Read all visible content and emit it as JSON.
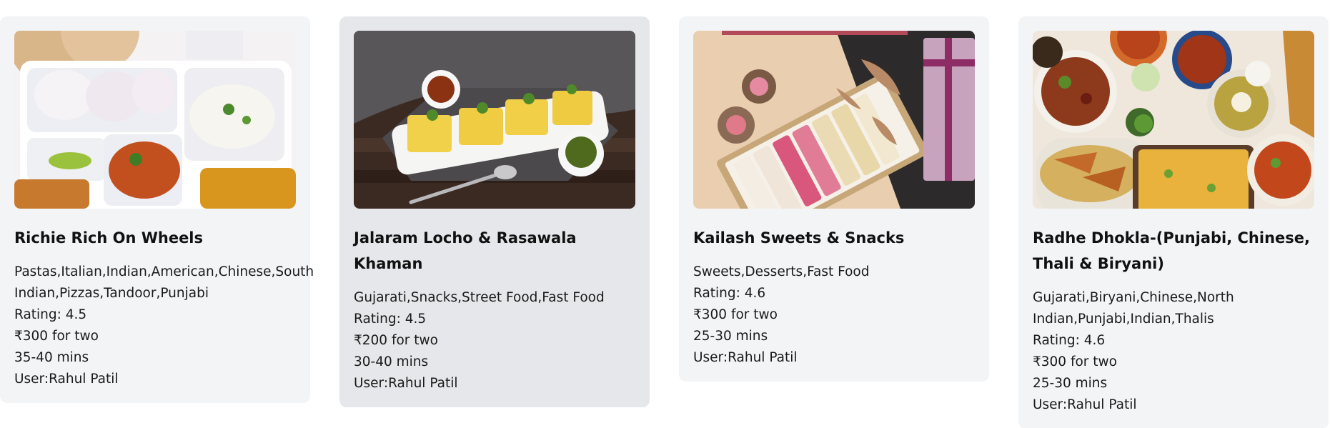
{
  "restaurants": [
    {
      "name": "Richie Rich On Wheels",
      "cuisines": "Pastas,Italian,Indian,American,Chinese,South Indian,Pizzas,Tandoor,Punjabi",
      "rating": "Rating: 4.5",
      "cost": "₹300 for two",
      "delivery_time": "35-40 mins",
      "user": "User:Rahul Patil",
      "image_icon": "thali-plate-photo"
    },
    {
      "name": "Jalaram Locho & Rasawala Khaman",
      "cuisines": "Gujarati,Snacks,Street Food,Fast Food",
      "rating": "Rating: 4.5",
      "cost": "₹200 for two",
      "delivery_time": "30-40 mins",
      "user": "User:Rahul Patil",
      "image_icon": "dhokla-platter-photo"
    },
    {
      "name": "Kailash Sweets & Snacks",
      "cuisines": "Sweets,Desserts,Fast Food",
      "rating": "Rating: 4.6",
      "cost": "₹300 for two",
      "delivery_time": "25-30 mins",
      "user": "User:Rahul Patil",
      "image_icon": "sweets-box-photo"
    },
    {
      "name": "Radhe Dhokla-(Punjabi, Chinese, Thali & Biryani)",
      "cuisines": "Gujarati,Biryani,Chinese,North Indian,Punjabi,Indian,Thalis",
      "rating": "Rating: 4.6",
      "cost": "₹300 for two",
      "delivery_time": "25-30 mins",
      "user": "User:Rahul Patil",
      "image_icon": "food-spread-photo"
    }
  ],
  "colors": {
    "card_bg": "#f3f4f6",
    "card_hover_bg": "#e6e7ea",
    "title": "#111111",
    "text": "#1a1a1a"
  }
}
